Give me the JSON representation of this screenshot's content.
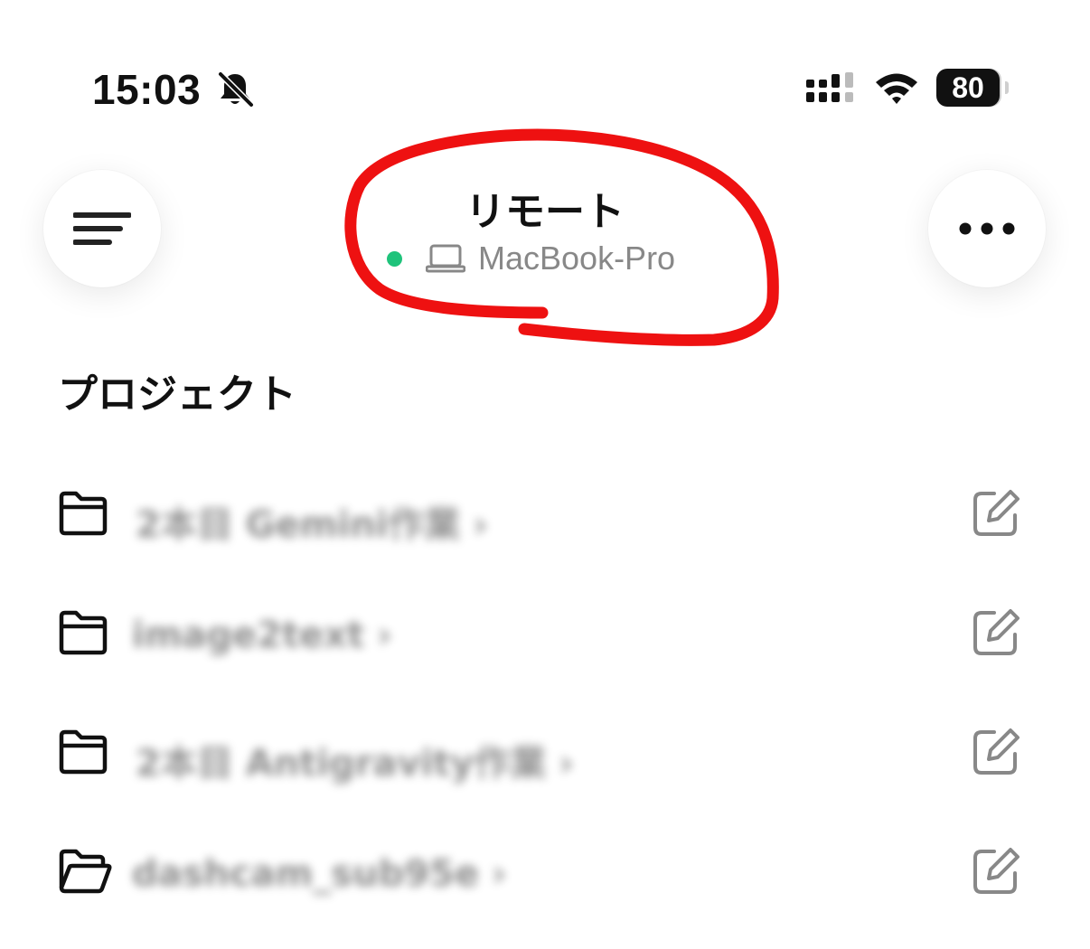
{
  "status_bar": {
    "time": "15:03",
    "battery": "80",
    "icons": [
      "bell-slash-icon",
      "signal-icon",
      "wifi-icon",
      "battery-icon"
    ]
  },
  "header": {
    "title": "リモート",
    "device_name": "MacBook-Pro",
    "device_status_color": "#1fc37b",
    "menu_icon": "menu-icon",
    "more_icon": "more-horizontal-icon"
  },
  "section": {
    "title": "プロジェクト"
  },
  "projects": [
    {
      "name": "2本目 Gemini作業 ›",
      "icon": "folder-icon",
      "action_icon": "edit-icon"
    },
    {
      "name": "image2text ›",
      "icon": "folder-icon",
      "action_icon": "edit-icon"
    },
    {
      "name": "2本目 Antigravity作業 ›",
      "icon": "folder-icon",
      "action_icon": "edit-icon"
    },
    {
      "name": "dashcam_sub95e ›",
      "icon": "folder-open-icon",
      "action_icon": "edit-icon"
    }
  ],
  "colors": {
    "annotation": "#ee1111",
    "accent_online": "#1fc37b",
    "muted_text": "#888888"
  }
}
